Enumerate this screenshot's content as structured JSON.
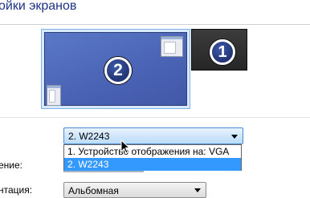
{
  "header": {
    "title": "ойки экранов"
  },
  "displays": [
    {
      "number": "2",
      "selected": true
    },
    {
      "number": "1",
      "selected": false
    }
  ],
  "display_select": {
    "value": "2. W2243",
    "options": [
      "1. Устройство отображения на: VGA",
      "2. W2243"
    ],
    "highlighted_option": "2. W2243"
  },
  "labels": {
    "resolution": "ение:",
    "orientation": "нтация:"
  },
  "orientation_select": {
    "value": "Альбомная"
  },
  "colors": {
    "accent": "#3399ff",
    "title": "#1e3287"
  },
  "icons": [
    "mouse-pointer-icon",
    "chevron-down-icon"
  ]
}
